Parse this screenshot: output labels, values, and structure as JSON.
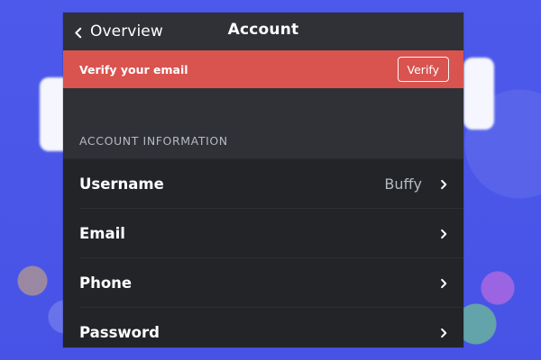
{
  "header": {
    "back_label": "Overview",
    "title": "Account"
  },
  "banner": {
    "text": "Verify your email",
    "button_label": "Verify",
    "color": "#d9534f"
  },
  "section": {
    "title": "ACCOUNT INFORMATION"
  },
  "rows": [
    {
      "label": "Username",
      "value": "Buffy"
    },
    {
      "label": "Email",
      "value": ""
    },
    {
      "label": "Phone",
      "value": ""
    },
    {
      "label": "Password",
      "value": ""
    }
  ],
  "icons": {
    "back": "chevron-left-icon",
    "row_chevron": "chevron-right-icon"
  },
  "colors": {
    "background_blue": "#4a57e8",
    "panel_dark": "#2f3136",
    "list_dark": "#232428",
    "muted_text": "#b5bac1"
  }
}
